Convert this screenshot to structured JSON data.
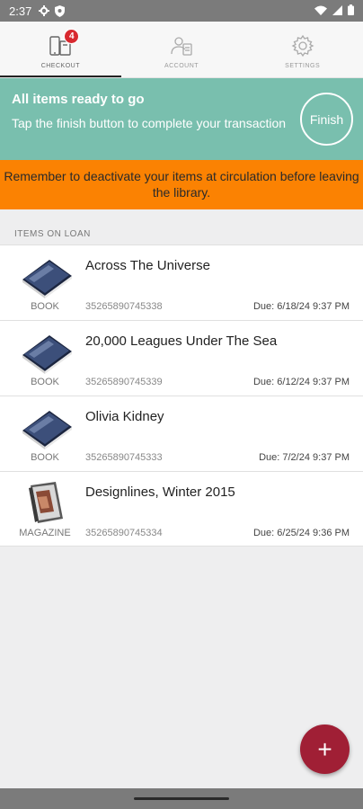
{
  "status_bar": {
    "time": "2:37"
  },
  "tabs": [
    {
      "label": "CHECKOUT",
      "badge": "4",
      "active": true
    },
    {
      "label": "ACCOUNT",
      "active": false
    },
    {
      "label": "SETTINGS",
      "active": false
    }
  ],
  "ready_banner": {
    "title": "All items ready to go",
    "description": "Tap the finish button to complete your transaction",
    "finish_label": "Finish",
    "background": "#79bfae"
  },
  "warning_banner": {
    "text": "Remember to deactivate your items at circulation before leaving the library.",
    "background": "#fb8202"
  },
  "loans": {
    "header": "ITEMS ON LOAN",
    "items": [
      {
        "title": "Across The Universe",
        "type": "BOOK",
        "barcode": "35265890745338",
        "due": "Due: 6/18/24 9:37 PM",
        "icon": "book-cover-icon"
      },
      {
        "title": "20,000 Leagues Under The Sea",
        "type": "BOOK",
        "barcode": "35265890745339",
        "due": "Due: 6/12/24 9:37 PM",
        "icon": "book-cover-icon"
      },
      {
        "title": "Olivia Kidney",
        "type": "BOOK",
        "barcode": "35265890745333",
        "due": "Due: 7/2/24 9:37 PM",
        "icon": "book-cover-icon"
      },
      {
        "title": "Designlines, Winter 2015",
        "type": "MAGAZINE",
        "barcode": "35265890745334",
        "due": "Due: 6/25/24 9:36 PM",
        "icon": "magazine-cover-icon"
      }
    ]
  },
  "fab": {
    "label": "+",
    "color": "#a01f35"
  }
}
